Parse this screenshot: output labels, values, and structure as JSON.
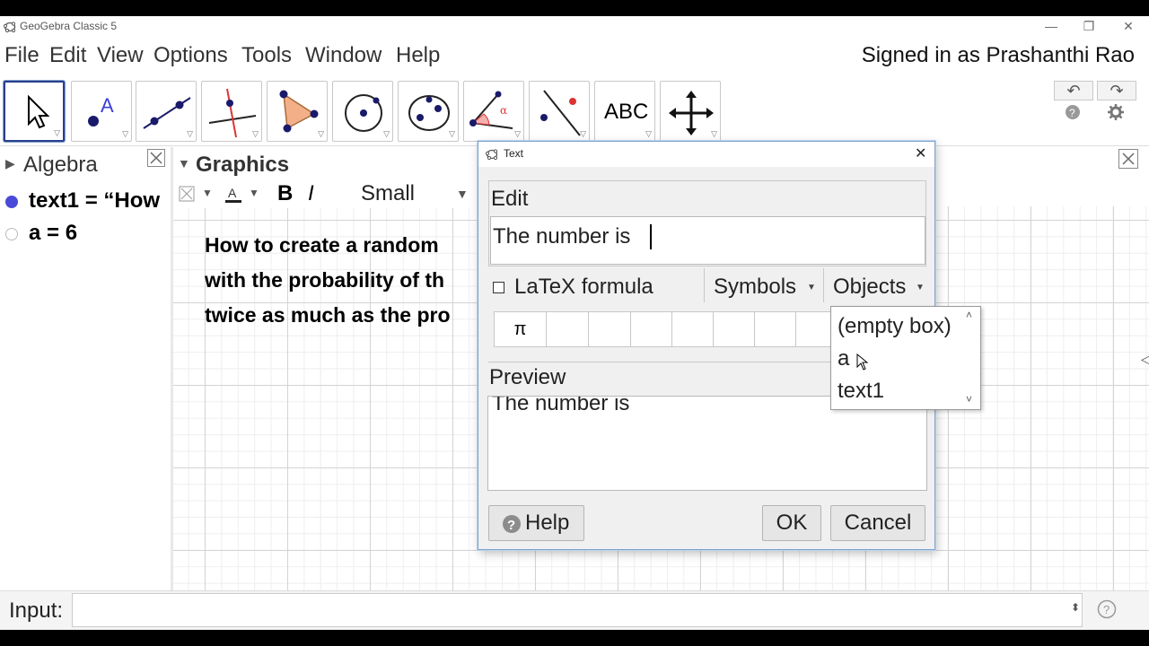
{
  "window": {
    "title": "GeoGebra Classic 5",
    "controls": {
      "minimize": "—",
      "restore": "❐",
      "close": "✕"
    }
  },
  "menubar": {
    "items": [
      "File",
      "Edit",
      "View",
      "Options",
      "Tools",
      "Window",
      "Help"
    ],
    "signed_in": "Signed in as Prashanthi Rao"
  },
  "toolbar": {
    "tools": [
      {
        "icon": "move-arrow-icon",
        "selected": true
      },
      {
        "icon": "point-icon"
      },
      {
        "icon": "line-icon"
      },
      {
        "icon": "perpendicular-line-icon"
      },
      {
        "icon": "polygon-icon"
      },
      {
        "icon": "circle-icon"
      },
      {
        "icon": "ellipse-icon"
      },
      {
        "icon": "angle-icon"
      },
      {
        "icon": "reflect-icon"
      },
      {
        "icon": "text-tool-icon",
        "label": "ABC"
      },
      {
        "icon": "move-graphics-icon"
      }
    ],
    "undo": "↶",
    "redo": "↷"
  },
  "algebra": {
    "title": "Algebra",
    "items": [
      {
        "text": "text1 = “How",
        "visible": true
      },
      {
        "text": "a = 6",
        "visible": false
      }
    ]
  },
  "graphics": {
    "title": "Graphics",
    "style_bar": {
      "bold": "B",
      "italic": "I",
      "size": "Small"
    },
    "text_lines": [
      "How to create a random",
      " with the probability of th",
      "twice as much as the pro"
    ]
  },
  "dialog": {
    "title": "Text",
    "edit_label": "Edit",
    "edit_value": "The number is ",
    "latex_label": "LaTeX formula",
    "latex_checked": false,
    "symbols_label": "Symbols",
    "objects_label": "Objects",
    "symbol_first": "π",
    "preview_label": "Preview",
    "preview_text": "The number is",
    "help_label": "Help",
    "ok_label": "OK",
    "cancel_label": "Cancel",
    "objects_popup": [
      "(empty box)",
      "a",
      "text1"
    ]
  },
  "inputbar": {
    "label": "Input:",
    "value": ""
  },
  "colors": {
    "accent": "#2a3f8c",
    "point_blue": "#3b3fd8",
    "line_red": "#d33",
    "polygon_fill": "#f3b088"
  }
}
